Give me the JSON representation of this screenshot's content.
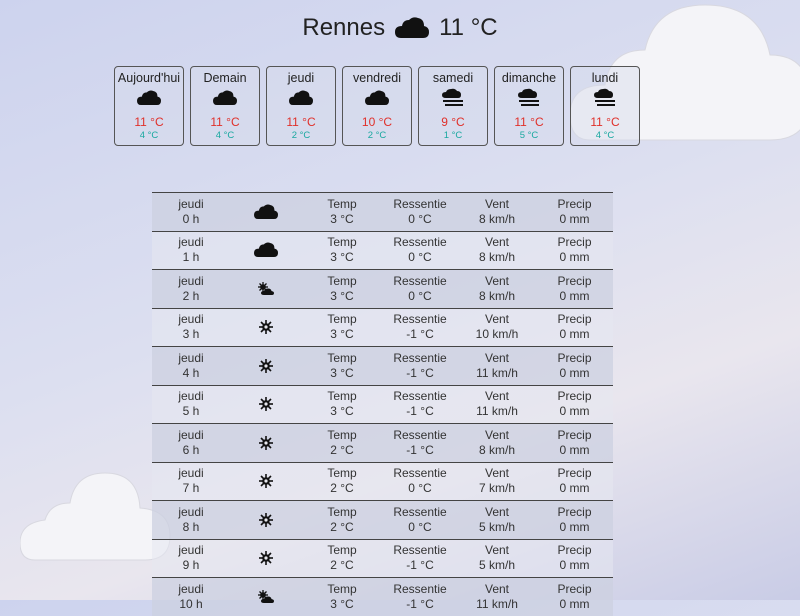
{
  "header": {
    "city": "Rennes",
    "icon": "cloud-icon",
    "temp": "11 °C"
  },
  "days": [
    {
      "name": "Aujourd'hui",
      "icon": "cloud-icon",
      "max": "11 °C",
      "min": "4 °C"
    },
    {
      "name": "Demain",
      "icon": "cloud-icon",
      "max": "11 °C",
      "min": "4 °C"
    },
    {
      "name": "jeudi",
      "icon": "cloud-icon",
      "max": "11 °C",
      "min": "2 °C"
    },
    {
      "name": "vendredi",
      "icon": "cloud-icon",
      "max": "10 °C",
      "min": "2 °C"
    },
    {
      "name": "samedi",
      "icon": "fog-icon",
      "max": "9 °C",
      "min": "1 °C"
    },
    {
      "name": "dimanche",
      "icon": "fog-icon",
      "max": "11 °C",
      "min": "5 °C"
    },
    {
      "name": "lundi",
      "icon": "fog-icon",
      "max": "11 °C",
      "min": "4 °C"
    }
  ],
  "labels": {
    "temp": "Temp",
    "feels": "Ressentie",
    "wind": "Vent",
    "precip": "Precip"
  },
  "hours": [
    {
      "day": "jeudi",
      "hour": "0 h",
      "icon": "cloud-icon",
      "temp": "3 °C",
      "feels": "0 °C",
      "wind": "8 km/h",
      "precip": "0 mm"
    },
    {
      "day": "jeudi",
      "hour": "1 h",
      "icon": "cloud-icon",
      "temp": "3 °C",
      "feels": "0 °C",
      "wind": "8 km/h",
      "precip": "0 mm"
    },
    {
      "day": "jeudi",
      "hour": "2 h",
      "icon": "partly-cloudy-icon",
      "temp": "3 °C",
      "feels": "0 °C",
      "wind": "8 km/h",
      "precip": "0 mm"
    },
    {
      "day": "jeudi",
      "hour": "3 h",
      "icon": "sun-icon",
      "temp": "3 °C",
      "feels": "-1 °C",
      "wind": "10 km/h",
      "precip": "0 mm"
    },
    {
      "day": "jeudi",
      "hour": "4 h",
      "icon": "sun-icon",
      "temp": "3 °C",
      "feels": "-1 °C",
      "wind": "11 km/h",
      "precip": "0 mm"
    },
    {
      "day": "jeudi",
      "hour": "5 h",
      "icon": "sun-icon",
      "temp": "3 °C",
      "feels": "-1 °C",
      "wind": "11 km/h",
      "precip": "0 mm"
    },
    {
      "day": "jeudi",
      "hour": "6 h",
      "icon": "sun-icon",
      "temp": "2 °C",
      "feels": "-1 °C",
      "wind": "8 km/h",
      "precip": "0 mm"
    },
    {
      "day": "jeudi",
      "hour": "7 h",
      "icon": "sun-icon",
      "temp": "2 °C",
      "feels": "0 °C",
      "wind": "7 km/h",
      "precip": "0 mm"
    },
    {
      "day": "jeudi",
      "hour": "8 h",
      "icon": "sun-icon",
      "temp": "2 °C",
      "feels": "0 °C",
      "wind": "5 km/h",
      "precip": "0 mm"
    },
    {
      "day": "jeudi",
      "hour": "9 h",
      "icon": "sun-icon",
      "temp": "2 °C",
      "feels": "-1 °C",
      "wind": "5 km/h",
      "precip": "0 mm"
    },
    {
      "day": "jeudi",
      "hour": "10 h",
      "icon": "partly-cloudy-icon",
      "temp": "3 °C",
      "feels": "-1 °C",
      "wind": "11 km/h",
      "precip": "0 mm"
    }
  ]
}
